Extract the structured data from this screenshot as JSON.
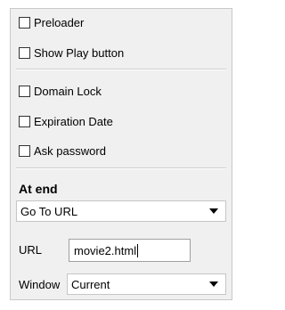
{
  "options": {
    "preloader": {
      "label": "Preloader",
      "checked": false
    },
    "show_play_button": {
      "label": "Show Play button",
      "checked": false
    },
    "domain_lock": {
      "label": "Domain Lock",
      "checked": false
    },
    "expiration_date": {
      "label": "Expiration Date",
      "checked": false
    },
    "ask_password": {
      "label": "Ask password",
      "checked": false
    }
  },
  "at_end": {
    "title": "At end",
    "action": {
      "selected": "Go To URL"
    },
    "url": {
      "label": "URL",
      "value": "movie2.html"
    },
    "window": {
      "label": "Window",
      "selected": "Current"
    }
  }
}
